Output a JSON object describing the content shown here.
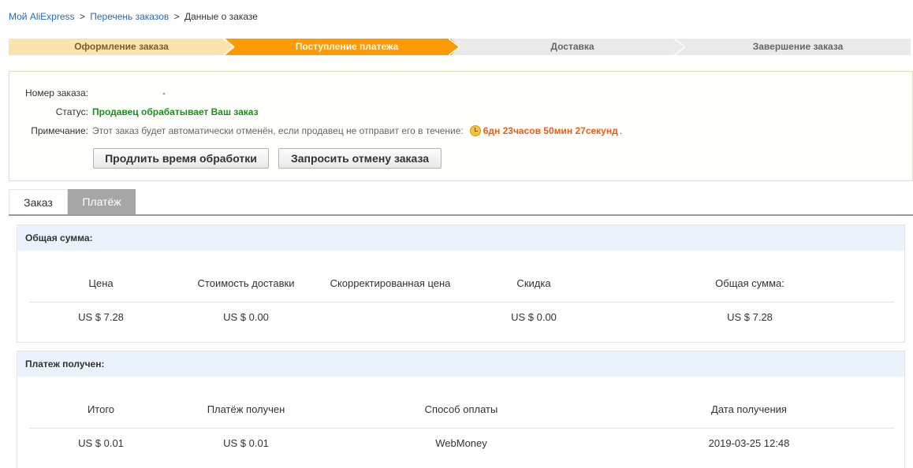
{
  "breadcrumb": {
    "my_aliexpress": "Мой AliExpress",
    "orders_list": "Перечень заказов",
    "order_details": "Данные о заказе",
    "separator": ">"
  },
  "steps": [
    {
      "label": "Оформление заказа",
      "state": "done"
    },
    {
      "label": "Поступление платежа",
      "state": "active"
    },
    {
      "label": "Доставка",
      "state": "pending"
    },
    {
      "label": "Завершение заказа",
      "state": "pending"
    }
  ],
  "order": {
    "number_label": "Номер заказа:",
    "number_value": "-",
    "status_label": "Статус:",
    "status_value": "Продавец обрабатывает Ваш заказ",
    "note_label": "Примечание:",
    "note_text": "Этот заказ будет автоматически отменён, если продавец не отправит его в течение:",
    "countdown": "6дн 23часов 50мин 27секунд",
    "countdown_suffix": ".",
    "extend_button": "Продлить время обработки",
    "cancel_button": "Запросить отмену заказа"
  },
  "tabs": [
    {
      "label": "Заказ",
      "active": false
    },
    {
      "label": "Платёж",
      "active": true
    }
  ],
  "total_panel": {
    "title": "Общая сумма:",
    "headers": [
      "Цена",
      "Стоимость доставки",
      "Скорректированная цена",
      "Скидка",
      "Общая сумма:"
    ],
    "values": [
      "US $ 7.28",
      "US $ 0.00",
      "",
      "US $ 0.00",
      "US $ 7.28"
    ]
  },
  "paid_panel": {
    "title": "Платеж получен:",
    "headers": [
      "Итого",
      "Платёж получен",
      "Способ оплаты",
      "Дата получения"
    ],
    "values": [
      "US $ 0.01",
      "US $ 0.01",
      "WebMoney",
      "2019-03-25 12:48"
    ]
  },
  "colors": {
    "link": "#2a6ab6",
    "step_done": "#fbe3ad",
    "step_active": "#ff9a04",
    "step_pending": "#eaeaea",
    "status_green": "#1e8e1e",
    "countdown_orange": "#e8601c",
    "panel_header": "#eaf2fc"
  }
}
